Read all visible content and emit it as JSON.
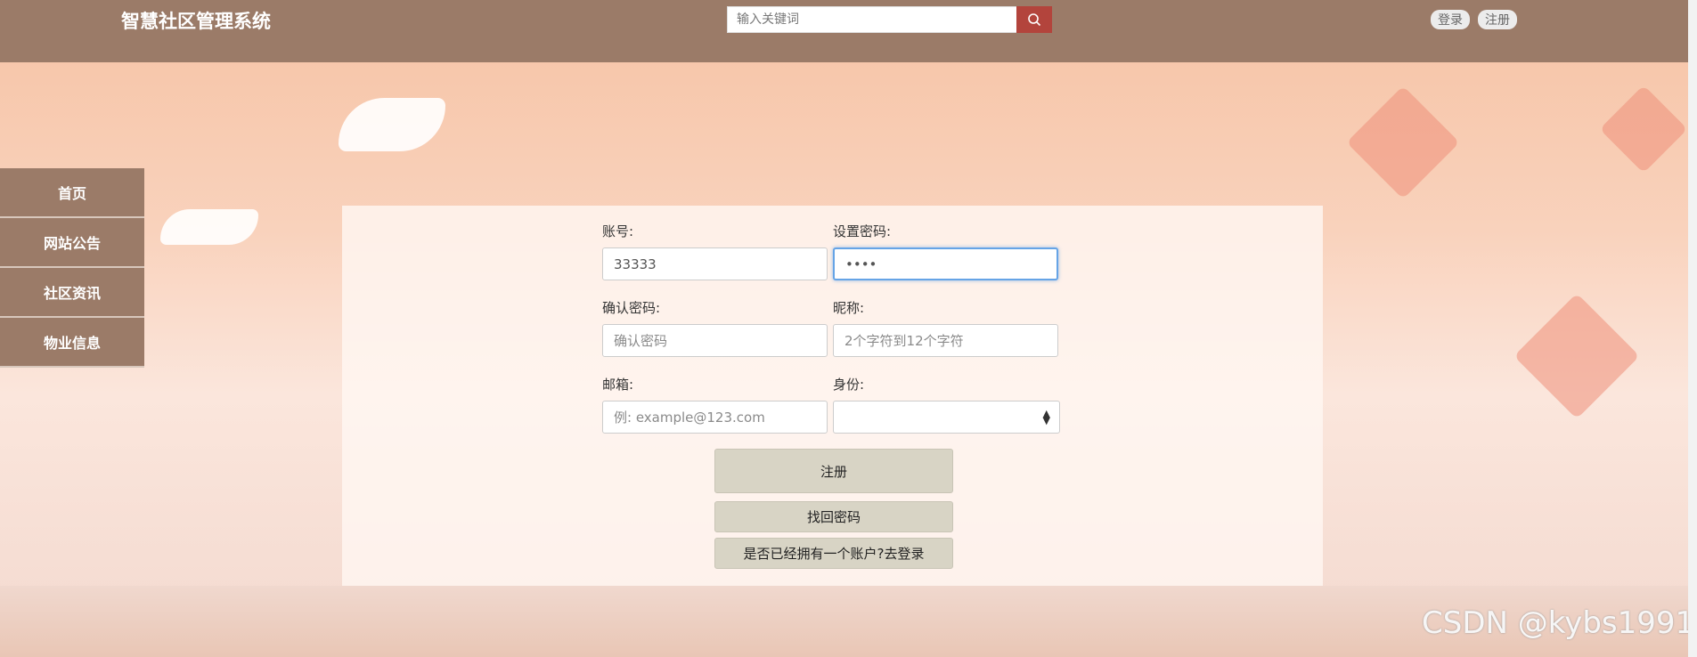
{
  "header": {
    "brand": "智慧社区管理系统",
    "search_placeholder": "输入关键词",
    "login_label": "登录",
    "register_label": "注册"
  },
  "sidebar": {
    "items": [
      {
        "label": "首页"
      },
      {
        "label": "网站公告"
      },
      {
        "label": "社区资讯"
      },
      {
        "label": "物业信息"
      }
    ]
  },
  "form": {
    "account_label": "账号:",
    "account_value": "33333",
    "password_label": "设置密码:",
    "password_value": "••••",
    "confirm_label": "确认密码:",
    "confirm_placeholder": "确认密码",
    "nickname_label": "昵称:",
    "nickname_placeholder": "2个字符到12个字符",
    "email_label": "邮箱:",
    "email_placeholder": "例: example@123.com",
    "role_label": "身份:",
    "register_button": "注册",
    "recover_button": "找回密码",
    "login_link_button": "是否已经拥有一个账户?去登录"
  },
  "watermark": "CSDN @kybs1991",
  "colors": {
    "header_bg": "#9b7b68",
    "search_button": "#b3443c",
    "button_bg": "#d8d4c5"
  },
  "icons": {
    "search": "search-icon",
    "select_arrow": "select-arrows-icon"
  }
}
